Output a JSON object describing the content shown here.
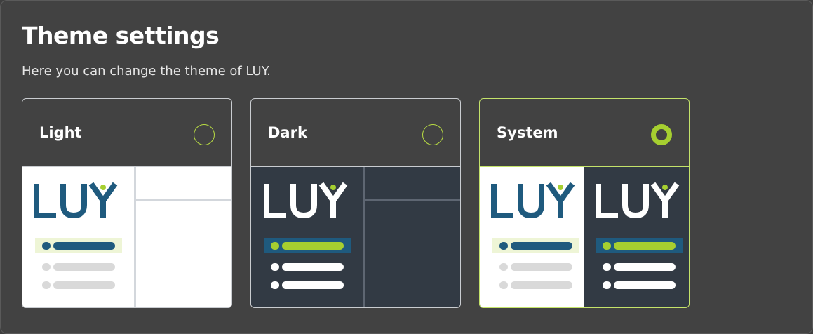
{
  "page": {
    "title": "Theme settings",
    "subtitle": "Here you can change the theme of LUY."
  },
  "themes": [
    {
      "label": "Light",
      "selected": false
    },
    {
      "label": "Dark",
      "selected": false
    },
    {
      "label": "System",
      "selected": true
    }
  ],
  "logo_text": "LUY",
  "colors": {
    "panel_bg": "#424242",
    "accent_green": "#a6cf30",
    "logo_blue": "#1f5a7e",
    "dark_preview_bg": "#323a44",
    "light_preview_bg": "#ffffff"
  },
  "icons": {
    "radio_unchecked": "radio-unchecked-icon",
    "radio_checked": "radio-checked-icon",
    "logo": "luy-logo"
  }
}
